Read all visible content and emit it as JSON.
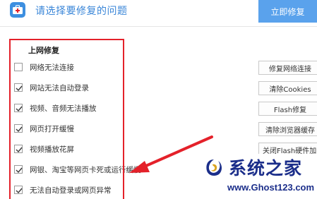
{
  "header": {
    "title": "请选择要修复的问题",
    "fix_now_label": "立即修复"
  },
  "section": {
    "title": "上网修复"
  },
  "items": [
    {
      "label": "网络无法连接",
      "checked": false,
      "action": "修复网络连接"
    },
    {
      "label": "网站无法自动登录",
      "checked": true,
      "action": "清除Cookies"
    },
    {
      "label": "视频、音频无法播放",
      "checked": true,
      "action": "Flash修复"
    },
    {
      "label": "网页打开缓慢",
      "checked": true,
      "action": "清除浏览器缓存"
    },
    {
      "label": "视频播放花屏",
      "checked": true,
      "action": "关闭Flash硬件加"
    },
    {
      "label": "网银、淘宝等网页卡死或运行缓慢",
      "checked": true,
      "action": ""
    },
    {
      "label": "无法自动登录或网页异常",
      "checked": true,
      "action": ""
    }
  ],
  "watermark": {
    "name": "系统之家",
    "url": "www.Ghost123.com"
  },
  "colors": {
    "accent": "#3a86d8",
    "button": "#5aa2ec",
    "highlight": "#e4212a",
    "watermark": "#1b2e8a"
  },
  "icons": {
    "app": "first-aid-kit-icon",
    "check": "check-icon",
    "arrow": "red-arrow-icon"
  }
}
